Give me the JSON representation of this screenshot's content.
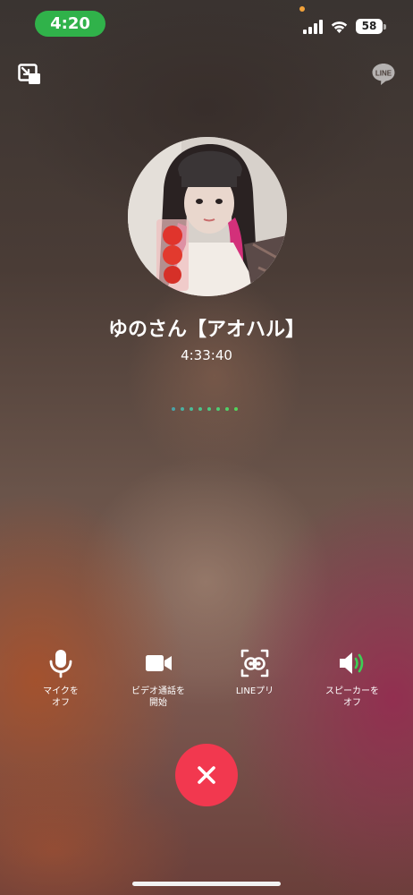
{
  "status_bar": {
    "time": "4:20",
    "battery": "58",
    "time_pill_color": "#30b24a",
    "icons": [
      "signal-icon",
      "wifi-icon",
      "battery-icon"
    ]
  },
  "top_bar": {
    "icons": [
      "minimize-pip-icon",
      "line-logo-icon"
    ],
    "line_logo_text": "LINE"
  },
  "call": {
    "caller_name": "ゆのさん【アオハル】",
    "duration": "4:33:40",
    "avatar": "caller-avatar-photo",
    "connection_dots_colors": [
      "#4aa3a8",
      "#4ab0a2",
      "#4bbb98",
      "#4cc38c",
      "#4dc880",
      "#4fcd74",
      "#51d168",
      "#53d45c"
    ]
  },
  "controls": [
    {
      "label": "マイクを\nオフ",
      "icon": "microphone-icon"
    },
    {
      "label": "ビデオ通話を\n開始",
      "icon": "video-camera-icon"
    },
    {
      "label": "LINEプリ",
      "icon": "line-puri-icon"
    },
    {
      "label": "スピーカーを\nオフ",
      "icon": "speaker-icon"
    }
  ],
  "end_call": {
    "icon": "close-icon",
    "color": "#f2384f"
  },
  "accent_colors": {
    "speaker_waves": "#3ccf55"
  }
}
